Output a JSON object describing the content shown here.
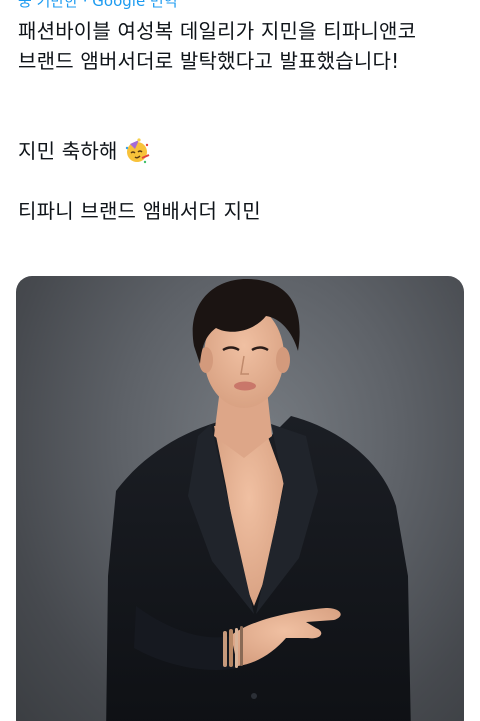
{
  "tweet": {
    "top_partial_text": "중 기반한 · Google 번역",
    "paragraph1": "패션바이블 여성복 데일리가 지민을 티파니앤코 브랜드 앰버서더로 발탁했다고 발표했습니다!",
    "paragraph2": "지민 축하해",
    "paragraph3": "티파니 브랜드 앰배서더 지민",
    "emoji": "partying-face-icon"
  },
  "media": {
    "description_icon": "photo",
    "colors": {
      "background": "#5e6268",
      "suit": "#15171c",
      "skin": "#e8b394",
      "hair": "#1b1412"
    }
  }
}
